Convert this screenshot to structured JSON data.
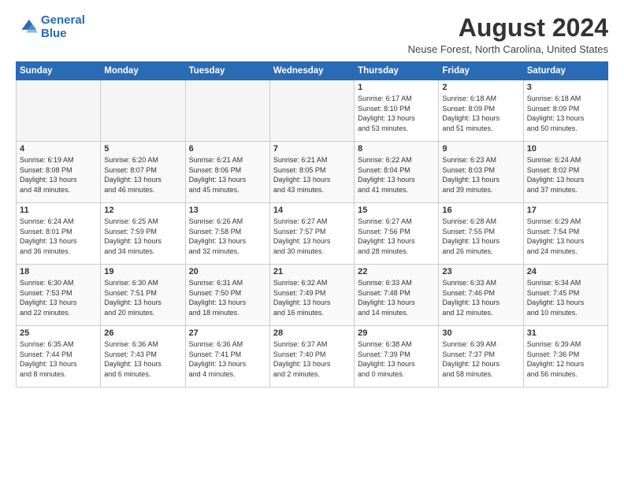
{
  "header": {
    "logo_line1": "General",
    "logo_line2": "Blue",
    "month_year": "August 2024",
    "location": "Neuse Forest, North Carolina, United States"
  },
  "weekdays": [
    "Sunday",
    "Monday",
    "Tuesday",
    "Wednesday",
    "Thursday",
    "Friday",
    "Saturday"
  ],
  "rows": [
    [
      {
        "day": "",
        "text": ""
      },
      {
        "day": "",
        "text": ""
      },
      {
        "day": "",
        "text": ""
      },
      {
        "day": "",
        "text": ""
      },
      {
        "day": "1",
        "text": "Sunrise: 6:17 AM\nSunset: 8:10 PM\nDaylight: 13 hours\nand 53 minutes."
      },
      {
        "day": "2",
        "text": "Sunrise: 6:18 AM\nSunset: 8:09 PM\nDaylight: 13 hours\nand 51 minutes."
      },
      {
        "day": "3",
        "text": "Sunrise: 6:18 AM\nSunset: 8:09 PM\nDaylight: 13 hours\nand 50 minutes."
      }
    ],
    [
      {
        "day": "4",
        "text": "Sunrise: 6:19 AM\nSunset: 8:08 PM\nDaylight: 13 hours\nand 48 minutes."
      },
      {
        "day": "5",
        "text": "Sunrise: 6:20 AM\nSunset: 8:07 PM\nDaylight: 13 hours\nand 46 minutes."
      },
      {
        "day": "6",
        "text": "Sunrise: 6:21 AM\nSunset: 8:06 PM\nDaylight: 13 hours\nand 45 minutes."
      },
      {
        "day": "7",
        "text": "Sunrise: 6:21 AM\nSunset: 8:05 PM\nDaylight: 13 hours\nand 43 minutes."
      },
      {
        "day": "8",
        "text": "Sunrise: 6:22 AM\nSunset: 8:04 PM\nDaylight: 13 hours\nand 41 minutes."
      },
      {
        "day": "9",
        "text": "Sunrise: 6:23 AM\nSunset: 8:03 PM\nDaylight: 13 hours\nand 39 minutes."
      },
      {
        "day": "10",
        "text": "Sunrise: 6:24 AM\nSunset: 8:02 PM\nDaylight: 13 hours\nand 37 minutes."
      }
    ],
    [
      {
        "day": "11",
        "text": "Sunrise: 6:24 AM\nSunset: 8:01 PM\nDaylight: 13 hours\nand 36 minutes."
      },
      {
        "day": "12",
        "text": "Sunrise: 6:25 AM\nSunset: 7:59 PM\nDaylight: 13 hours\nand 34 minutes."
      },
      {
        "day": "13",
        "text": "Sunrise: 6:26 AM\nSunset: 7:58 PM\nDaylight: 13 hours\nand 32 minutes."
      },
      {
        "day": "14",
        "text": "Sunrise: 6:27 AM\nSunset: 7:57 PM\nDaylight: 13 hours\nand 30 minutes."
      },
      {
        "day": "15",
        "text": "Sunrise: 6:27 AM\nSunset: 7:56 PM\nDaylight: 13 hours\nand 28 minutes."
      },
      {
        "day": "16",
        "text": "Sunrise: 6:28 AM\nSunset: 7:55 PM\nDaylight: 13 hours\nand 26 minutes."
      },
      {
        "day": "17",
        "text": "Sunrise: 6:29 AM\nSunset: 7:54 PM\nDaylight: 13 hours\nand 24 minutes."
      }
    ],
    [
      {
        "day": "18",
        "text": "Sunrise: 6:30 AM\nSunset: 7:53 PM\nDaylight: 13 hours\nand 22 minutes."
      },
      {
        "day": "19",
        "text": "Sunrise: 6:30 AM\nSunset: 7:51 PM\nDaylight: 13 hours\nand 20 minutes."
      },
      {
        "day": "20",
        "text": "Sunrise: 6:31 AM\nSunset: 7:50 PM\nDaylight: 13 hours\nand 18 minutes."
      },
      {
        "day": "21",
        "text": "Sunrise: 6:32 AM\nSunset: 7:49 PM\nDaylight: 13 hours\nand 16 minutes."
      },
      {
        "day": "22",
        "text": "Sunrise: 6:33 AM\nSunset: 7:48 PM\nDaylight: 13 hours\nand 14 minutes."
      },
      {
        "day": "23",
        "text": "Sunrise: 6:33 AM\nSunset: 7:46 PM\nDaylight: 13 hours\nand 12 minutes."
      },
      {
        "day": "24",
        "text": "Sunrise: 6:34 AM\nSunset: 7:45 PM\nDaylight: 13 hours\nand 10 minutes."
      }
    ],
    [
      {
        "day": "25",
        "text": "Sunrise: 6:35 AM\nSunset: 7:44 PM\nDaylight: 13 hours\nand 8 minutes."
      },
      {
        "day": "26",
        "text": "Sunrise: 6:36 AM\nSunset: 7:43 PM\nDaylight: 13 hours\nand 6 minutes."
      },
      {
        "day": "27",
        "text": "Sunrise: 6:36 AM\nSunset: 7:41 PM\nDaylight: 13 hours\nand 4 minutes."
      },
      {
        "day": "28",
        "text": "Sunrise: 6:37 AM\nSunset: 7:40 PM\nDaylight: 13 hours\nand 2 minutes."
      },
      {
        "day": "29",
        "text": "Sunrise: 6:38 AM\nSunset: 7:39 PM\nDaylight: 13 hours\nand 0 minutes."
      },
      {
        "day": "30",
        "text": "Sunrise: 6:39 AM\nSunset: 7:37 PM\nDaylight: 12 hours\nand 58 minutes."
      },
      {
        "day": "31",
        "text": "Sunrise: 6:39 AM\nSunset: 7:36 PM\nDaylight: 12 hours\nand 56 minutes."
      }
    ]
  ]
}
